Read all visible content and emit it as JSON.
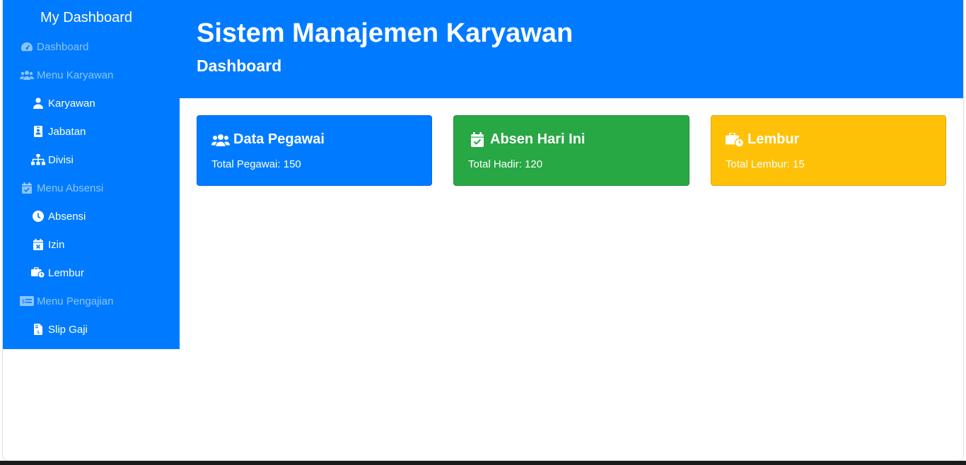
{
  "sidebar": {
    "brand": "My Dashboard",
    "items": [
      {
        "label": "Dashboard",
        "icon": "tachometer-icon",
        "type": "group"
      },
      {
        "label": "Menu Karyawan",
        "icon": "users-icon",
        "type": "group"
      },
      {
        "label": "Karyawan",
        "icon": "user-icon",
        "type": "sub"
      },
      {
        "label": "Jabatan",
        "icon": "id-badge-icon",
        "type": "sub"
      },
      {
        "label": "Divisi",
        "icon": "sitemap-icon",
        "type": "sub"
      },
      {
        "label": "Menu Absensi",
        "icon": "calendar-check-icon",
        "type": "group"
      },
      {
        "label": "Absensi",
        "icon": "clock-icon",
        "type": "sub"
      },
      {
        "label": "Izin",
        "icon": "calendar-times-icon",
        "type": "sub"
      },
      {
        "label": "Lembur",
        "icon": "business-time-icon",
        "type": "sub"
      },
      {
        "label": "Menu Pengajian",
        "icon": "money-check-icon",
        "type": "group"
      },
      {
        "label": "Slip Gaji",
        "icon": "file-invoice-dollar-icon",
        "type": "sub"
      }
    ]
  },
  "header": {
    "title": "Sistem Manajemen Karyawan",
    "subtitle": "Dashboard"
  },
  "cards": [
    {
      "title": "Data Pegawai",
      "text": "Total Pegawai: 150",
      "icon": "users-icon",
      "color": "#007bff"
    },
    {
      "title": "Absen Hari Ini",
      "text": "Total Hadir: 120",
      "icon": "calendar-check-icon",
      "color": "#28a745"
    },
    {
      "title": "Lembur",
      "text": "Total Lembur: 15",
      "icon": "business-time-icon",
      "color": "#ffc107"
    }
  ],
  "colors": {
    "primary": "#007bff",
    "success": "#28a745",
    "warning": "#ffc107"
  }
}
